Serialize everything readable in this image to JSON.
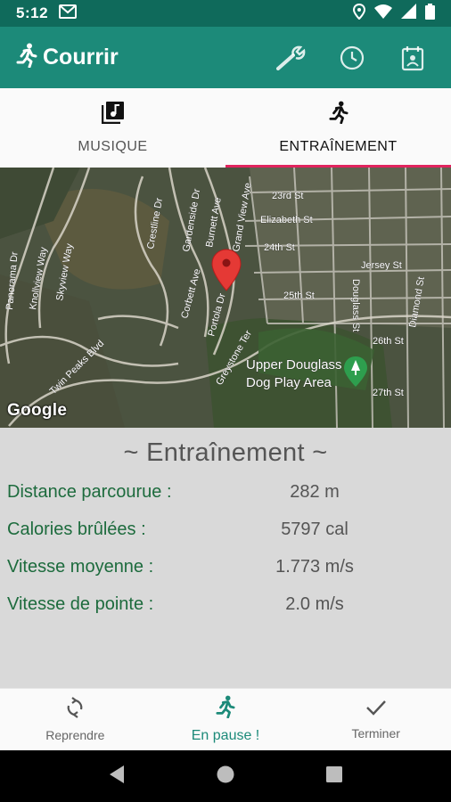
{
  "status_bar": {
    "time": "5:12"
  },
  "app_bar": {
    "title": "Courrir",
    "icons": [
      "runner-icon",
      "wrench-icon",
      "clock-icon",
      "calendar-icon"
    ]
  },
  "tabs": [
    {
      "label": "MUSIQUE",
      "icon": "music-library-icon",
      "active": false
    },
    {
      "label": "ENTRAÎNEMENT",
      "icon": "runner-icon",
      "active": true
    }
  ],
  "map": {
    "attribution": "Google",
    "streets": [
      "Elizabeth St",
      "24th St",
      "Jersey St",
      "25th St",
      "Douglass St",
      "Diamond St",
      "26th St",
      "27th St",
      "Crestline Dr",
      "Gardenside Dr",
      "Twin Peaks Blvd",
      "Knollview Way",
      "Skyview Way",
      "Panorama Dr",
      "Corbett Ave",
      "Greystone Ter",
      "Portola Dr",
      "Grand View Ave",
      "23rd St",
      "Burnett Ave"
    ],
    "place": "Upper Douglass Dog Play Area"
  },
  "workout": {
    "heading": "~ Entraînement  ~",
    "stats": [
      {
        "label": "Distance parcourue :",
        "value": "282 m"
      },
      {
        "label": "Calories brûlées :",
        "value": "5797 cal"
      },
      {
        "label": "Vitesse moyenne :",
        "value": "1.773 m/s"
      },
      {
        "label": "Vitesse de pointe :",
        "value": "2.0 m/s"
      }
    ]
  },
  "bottom_nav": [
    {
      "label": "Reprendre",
      "icon": "refresh-icon",
      "active": false
    },
    {
      "label": "En pause !",
      "icon": "runner-icon",
      "active": true
    },
    {
      "label": "Terminer",
      "icon": "check-icon",
      "active": false
    }
  ],
  "colors": {
    "accent": "#1c8a79",
    "status": "#0f6a5b",
    "tab_indicator": "#e0245e",
    "stat_label": "#1d6b3d"
  }
}
